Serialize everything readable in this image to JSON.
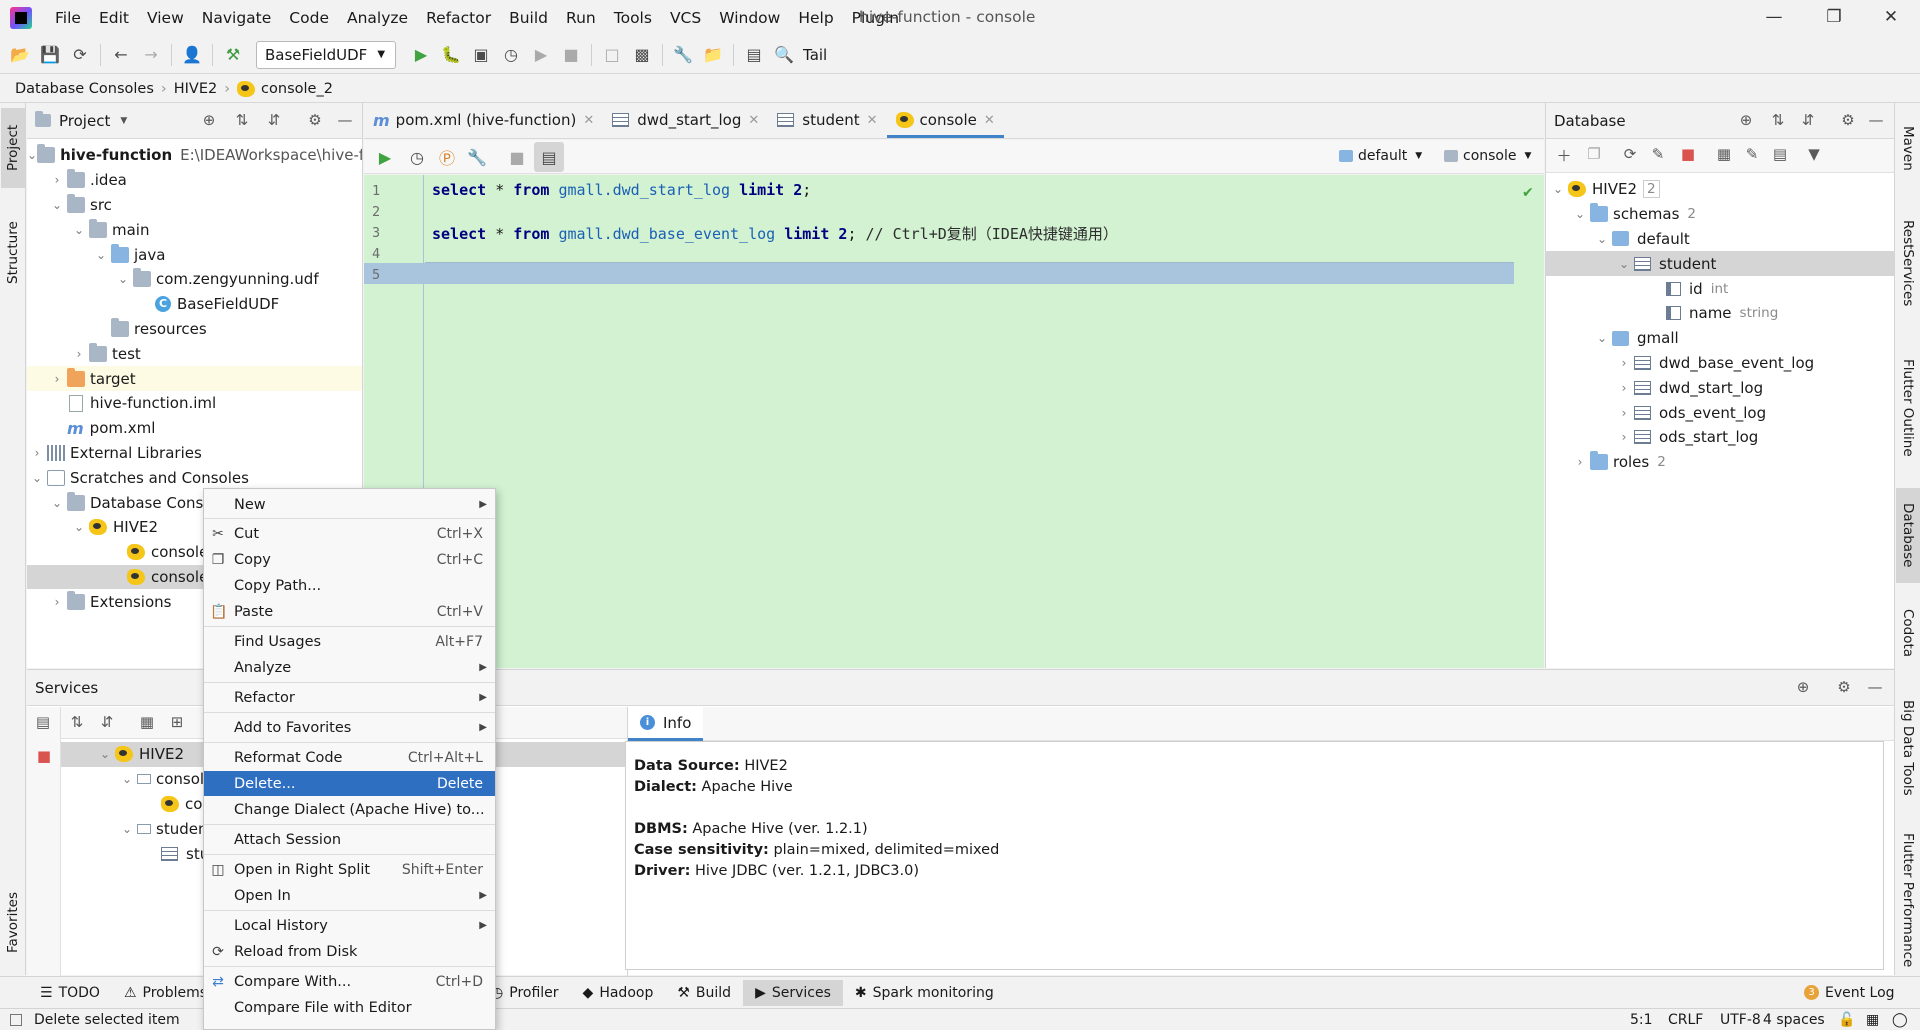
{
  "menubar": {
    "items": [
      "File",
      "Edit",
      "View",
      "Navigate",
      "Code",
      "Analyze",
      "Refactor",
      "Build",
      "Run",
      "Tools",
      "VCS",
      "Window",
      "Help",
      "Plugin"
    ],
    "window_title": "hive-function - console"
  },
  "toolbar": {
    "run_config": "BaseFieldUDF",
    "tail_label": "Tail"
  },
  "breadcrumb": [
    "Database Consoles",
    "HIVE2",
    "console_2"
  ],
  "left_stripe": {
    "project": "Project",
    "structure": "Structure",
    "favorites": "Favorites"
  },
  "right_stripe": [
    "Maven",
    "RestServices",
    "Flutter Outline",
    "Database",
    "Codota",
    "Big Data Tools",
    "Flutter Performance"
  ],
  "project_panel": {
    "title": "Project",
    "tree": [
      {
        "label": "hive-function",
        "extra": "E:\\IDEAWorkspace\\hive-fun"
      },
      {
        "label": ".idea"
      },
      {
        "label": "src"
      },
      {
        "label": "main"
      },
      {
        "label": "java"
      },
      {
        "label": "com.zengyunning.udf"
      },
      {
        "label": "BaseFieldUDF"
      },
      {
        "label": "resources"
      },
      {
        "label": "test"
      },
      {
        "label": "target"
      },
      {
        "label": "hive-function.iml"
      },
      {
        "label": "pom.xml"
      },
      {
        "label": "External Libraries"
      },
      {
        "label": "Scratches and Consoles"
      },
      {
        "label": "Database Cons"
      },
      {
        "label": "HIVE2"
      },
      {
        "label": "console"
      },
      {
        "label": "console_"
      },
      {
        "label": "Extensions"
      }
    ]
  },
  "editor": {
    "tabs": [
      "pom.xml (hive-function)",
      "dwd_start_log",
      "student",
      "console"
    ],
    "datasource": "default",
    "console_selector": "console",
    "line_numbers": [
      "1",
      "2",
      "3",
      "4",
      "5"
    ],
    "lines": [
      {
        "kw1": "select",
        "star": "*",
        "kw2": "from",
        "table": "gmall.dwd_start_log",
        "kw3": "limit",
        "num": "2",
        "end": ";",
        "comment": ""
      },
      {
        "kw1": "select",
        "star": "*",
        "kw2": "from",
        "table": "gmall.dwd_base_event_log",
        "kw3": "limit",
        "num": "2",
        "end": ";",
        "comment": "// Ctrl+D复制（IDEA快捷键通用）"
      }
    ]
  },
  "database_panel": {
    "title": "Database",
    "tree": [
      {
        "label": "HIVE2",
        "badge": "2"
      },
      {
        "label": "schemas",
        "badge": "2"
      },
      {
        "label": "default"
      },
      {
        "label": "student"
      },
      {
        "label": "id",
        "type": "int"
      },
      {
        "label": "name",
        "type": "string"
      },
      {
        "label": "gmall"
      },
      {
        "label": "dwd_base_event_log"
      },
      {
        "label": "dwd_start_log"
      },
      {
        "label": "ods_event_log"
      },
      {
        "label": "ods_start_log"
      },
      {
        "label": "roles",
        "badge": "2"
      }
    ]
  },
  "services": {
    "title": "Services",
    "tree": [
      {
        "label": "HIVE2"
      },
      {
        "label": "console"
      },
      {
        "label": "consol"
      },
      {
        "label": "student",
        "extra": "9"
      },
      {
        "label": "studer"
      }
    ],
    "info_tab": "Info",
    "info": [
      {
        "key": "Data Source:",
        "value": "HIVE2"
      },
      {
        "key": "Dialect:",
        "value": "Apache Hive"
      },
      {
        "key": "DBMS:",
        "value": "Apache Hive (ver. 1.2.1)"
      },
      {
        "key": "Case sensitivity:",
        "value": "plain=mixed, delimited=mixed"
      },
      {
        "key": "Driver:",
        "value": "Hive JDBC (ver. 1.2.1, JDBC3.0)"
      }
    ]
  },
  "context_menu": {
    "items": [
      {
        "label": "New",
        "shortcut": "",
        "submenu": true
      },
      {
        "label": "Cut",
        "shortcut": "Ctrl+X"
      },
      {
        "label": "Copy",
        "shortcut": "Ctrl+C"
      },
      {
        "label": "Copy Path...",
        "shortcut": ""
      },
      {
        "label": "Paste",
        "shortcut": "Ctrl+V"
      },
      {
        "label": "Find Usages",
        "shortcut": "Alt+F7"
      },
      {
        "label": "Analyze",
        "shortcut": "",
        "submenu": true
      },
      {
        "label": "Refactor",
        "shortcut": "",
        "submenu": true
      },
      {
        "label": "Add to Favorites",
        "shortcut": "",
        "submenu": true
      },
      {
        "label": "Reformat Code",
        "shortcut": "Ctrl+Alt+L"
      },
      {
        "label": "Delete...",
        "shortcut": "Delete",
        "selected": true
      },
      {
        "label": "Change Dialect (Apache Hive) to...",
        "shortcut": ""
      },
      {
        "label": "Attach Session",
        "shortcut": ""
      },
      {
        "label": "Open in Right Split",
        "shortcut": "Shift+Enter"
      },
      {
        "label": "Open In",
        "shortcut": "",
        "submenu": true
      },
      {
        "label": "Local History",
        "shortcut": "",
        "submenu": true
      },
      {
        "label": "Reload from Disk",
        "shortcut": ""
      },
      {
        "label": "Compare With...",
        "shortcut": "Ctrl+D"
      },
      {
        "label": "Compare File with Editor",
        "shortcut": ""
      }
    ]
  },
  "bottom_bar": [
    "TODO",
    "Problems",
    "Profiler",
    "Hadoop",
    "Build",
    "Services",
    "Spark monitoring",
    "Event Log"
  ],
  "status_bar": {
    "message": "Delete selected item",
    "position": "5:1",
    "line_sep": "CRLF",
    "encoding": "UTF-8",
    "indent": "4 spaces"
  }
}
